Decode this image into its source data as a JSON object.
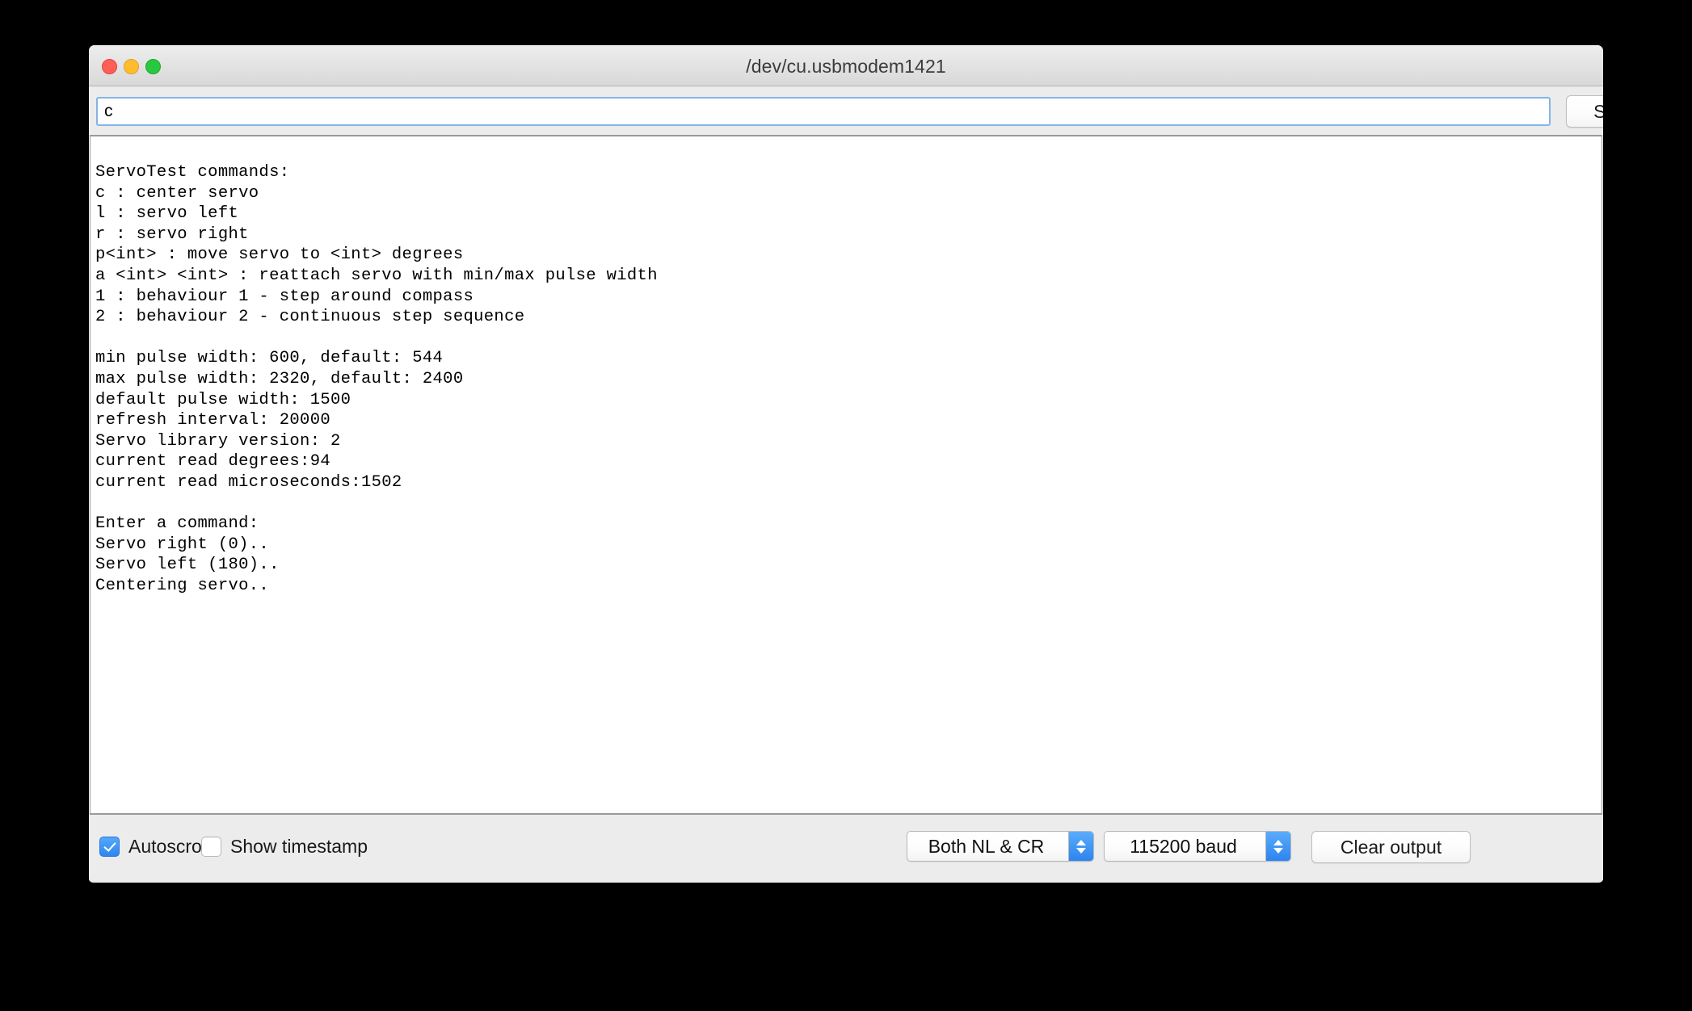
{
  "window": {
    "title": "/dev/cu.usbmodem1421"
  },
  "toolbar": {
    "input_value": "c",
    "input_placeholder": "",
    "send_label": "Send"
  },
  "console": {
    "text": "ServoTest commands:\nc : center servo\nl : servo left\nr : servo right\np<int> : move servo to <int> degrees\na <int> <int> : reattach servo with min/max pulse width\n1 : behaviour 1 - step around compass\n2 : behaviour 2 - continuous step sequence\n\nmin pulse width: 600, default: 544\nmax pulse width: 2320, default: 2400\ndefault pulse width: 1500\nrefresh interval: 20000\nServo library version: 2\ncurrent read degrees:94\ncurrent read microseconds:1502\n\nEnter a command:\nServo right (0)..\nServo left (180)..\nCentering servo..",
    "lines": [
      "ServoTest commands:",
      "c : center servo",
      "l : servo left",
      "r : servo right",
      "p<int> : move servo to <int> degrees",
      "a <int> <int> : reattach servo with min/max pulse width",
      "1 : behaviour 1 - step around compass",
      "2 : behaviour 2 - continuous step sequence",
      "",
      "min pulse width: 600, default: 544",
      "max pulse width: 2320, default: 2400",
      "default pulse width: 1500",
      "refresh interval: 20000",
      "Servo library version: 2",
      "current read degrees:94",
      "current read microseconds:1502",
      "",
      "Enter a command:",
      "Servo right (0)..",
      "Servo left (180)..",
      "Centering servo.."
    ]
  },
  "footer": {
    "autoscroll_label": "Autoscroll",
    "autoscroll_checked": true,
    "timestamp_label": "Show timestamp",
    "timestamp_checked": false,
    "line_ending_value": "Both NL & CR",
    "baud_value": "115200 baud",
    "clear_label": "Clear output"
  },
  "colors": {
    "accent_blue": "#2d84ef",
    "focus_border": "#83b4e8",
    "traffic_red": "#ff5f56",
    "traffic_yellow": "#ffbd2e",
    "traffic_green": "#28c840",
    "window_chrome": "#ececec",
    "console_background": "#ffffff",
    "console_text": "#000000"
  }
}
